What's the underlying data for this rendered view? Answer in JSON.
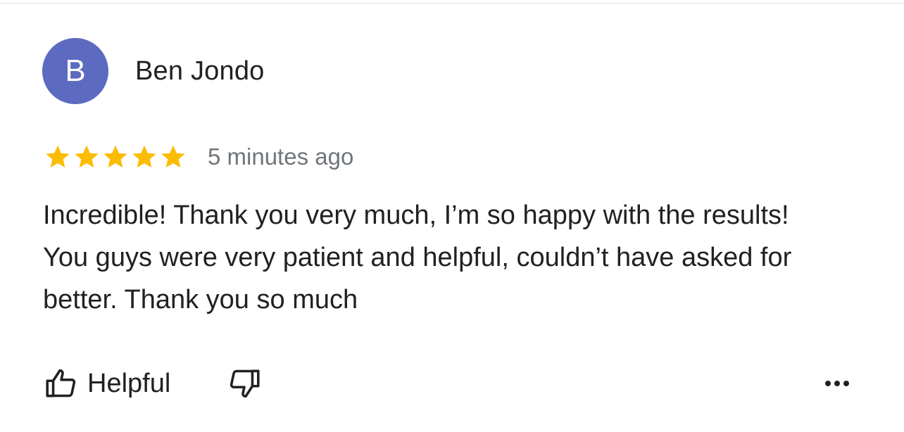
{
  "review": {
    "avatar_letter": "B",
    "avatar_color": "#5c6bc0",
    "author": "Ben Jondo",
    "rating": 5,
    "rating_max": 5,
    "star_color": "#fbbc04",
    "timestamp": "5 minutes ago",
    "text": "Incredible! Thank you very much, I’m so happy with the results! You guys were very patient and helpful, couldn’t have asked for better. Thank you so much"
  },
  "actions": {
    "helpful_label": "Helpful",
    "helpful_icon": "thumbs-up-icon",
    "unhelpful_icon": "thumbs-down-icon",
    "more_icon": "more-options-icon"
  }
}
